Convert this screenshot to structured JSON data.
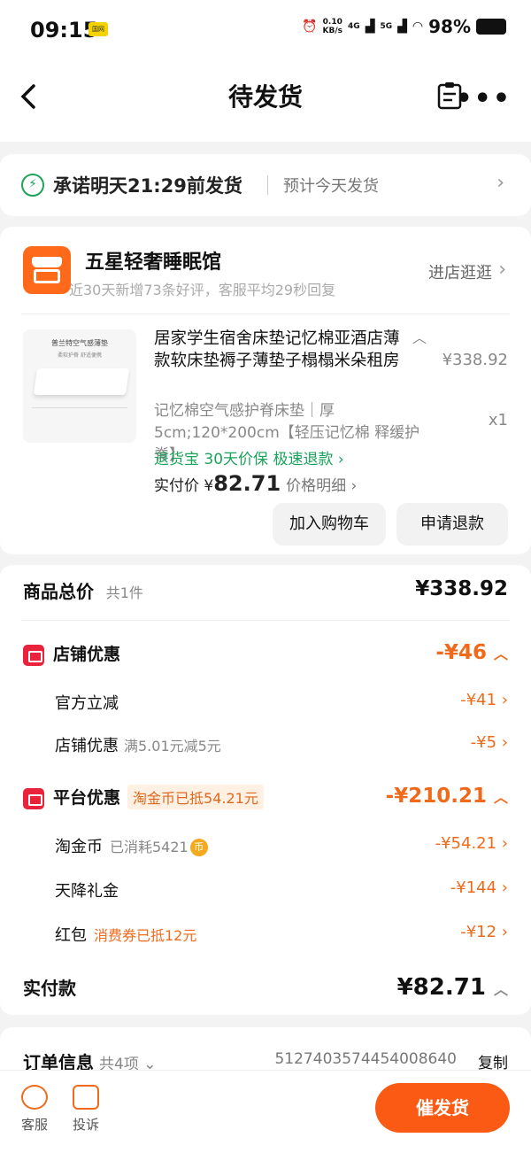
{
  "status": {
    "time": "09:15",
    "sim": "国网",
    "net_speed": "0.10",
    "net_unit": "KB/s",
    "sig1": "4G",
    "sig2": "5G",
    "battery": "98%"
  },
  "nav": {
    "title": "待发货",
    "more": "•••"
  },
  "promise": {
    "text": "承诺明天21:29前发货",
    "sub": "预计今天发货"
  },
  "shop": {
    "name": "五星轻奢睡眠馆",
    "sub": "近30天新增73条好评，客服平均29秒回复",
    "visit": "进店逛逛",
    "product": {
      "image_title": "普兰特空气感薄垫",
      "image_sub": "柔软护脊 舒适便携",
      "title": "居家学生宿舍床垫记忆棉亚酒店薄款软床垫褥子薄垫子榻榻米朵租房",
      "price": "¥338.92",
      "spec": "记忆棉空气感护脊床垫｜厚5cm;120*200cm【轻压记忆棉 释缓护脊】",
      "qty": "x1",
      "tags": "退货宝  30天价保  极速退款 ›",
      "paid_label": "实付价 ¥",
      "paid_value": "82.71",
      "price_detail": "价格明细 ›",
      "btn_cart": "加入购物车",
      "btn_refund": "申请退款"
    }
  },
  "totals": {
    "goods_label": "商品总价",
    "goods_count": "共1件",
    "goods_total": "¥338.92",
    "shop_disc_label": "店铺优惠",
    "shop_disc_total": "-¥46",
    "official_label": "官方立减",
    "official_value": "-¥41 ›",
    "shop_sub_label": "店铺优惠",
    "shop_sub_note": "满5.01元减5元",
    "shop_sub_value": "-¥5 ›",
    "plat_label": "平台优惠",
    "plat_chip": "淘金币已抵54.21元",
    "plat_total": "-¥210.21",
    "coin_label": "淘金币",
    "coin_note": "已消耗5421",
    "coin_value": "-¥54.21 ›",
    "gift_label": "天降礼金",
    "gift_value": "-¥144 ›",
    "red_label": "红包",
    "red_note": "消费券已抵12元",
    "red_value": "-¥12 ›",
    "paid_label": "实付款",
    "paid_value": "¥82.71"
  },
  "order": {
    "label": "订单信息",
    "count": "共4项 ⌄",
    "number": "5127403574454008640",
    "copy": "复制"
  },
  "bottom": {
    "service": "客服",
    "complain": "投诉",
    "cta": "催发货"
  },
  "colors": {
    "accent": "#fb5a14",
    "green": "#1aa35a",
    "red": "#e8233b"
  }
}
